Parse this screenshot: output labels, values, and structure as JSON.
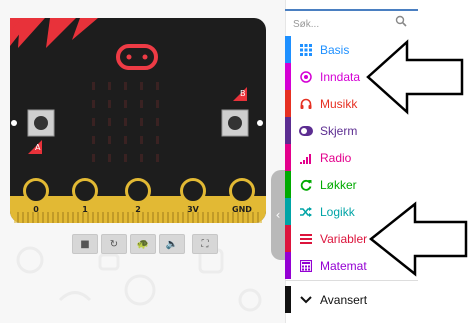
{
  "search": {
    "placeholder": "Søk..."
  },
  "categories": [
    {
      "label": "Basis",
      "color": "#1e90ff",
      "icon": "grid-icon"
    },
    {
      "label": "Inndata",
      "color": "#d400d4",
      "icon": "target-icon"
    },
    {
      "label": "Musikk",
      "color": "#e63022",
      "icon": "headphones-icon"
    },
    {
      "label": "Skjerm",
      "color": "#5c2d91",
      "icon": "toggle-icon"
    },
    {
      "label": "Radio",
      "color": "#e3008c",
      "icon": "signal-icon"
    },
    {
      "label": "Løkker",
      "color": "#00aa00",
      "icon": "refresh-icon"
    },
    {
      "label": "Logikk",
      "color": "#00a4a6",
      "icon": "shuffle-icon"
    },
    {
      "label": "Variabler",
      "color": "#dc143c",
      "icon": "list-icon"
    },
    {
      "label": "Matemat",
      "color": "#9400d3",
      "icon": "calculator-icon"
    }
  ],
  "advanced": {
    "label": "Avansert",
    "color": "#111111",
    "icon": "chevron-down-icon"
  },
  "board": {
    "pins": [
      "0",
      "1",
      "2",
      "3V",
      "GND"
    ],
    "button_a_label": "A",
    "button_b_label": "B"
  },
  "sim_controls": [
    {
      "name": "stop-button",
      "icon": "■"
    },
    {
      "name": "restart-button",
      "icon": "↻"
    },
    {
      "name": "slowmo-button",
      "icon": "🐢"
    },
    {
      "name": "mute-button",
      "icon": "🔈"
    },
    {
      "name": "screenshot-button",
      "icon": "⛶"
    }
  ]
}
